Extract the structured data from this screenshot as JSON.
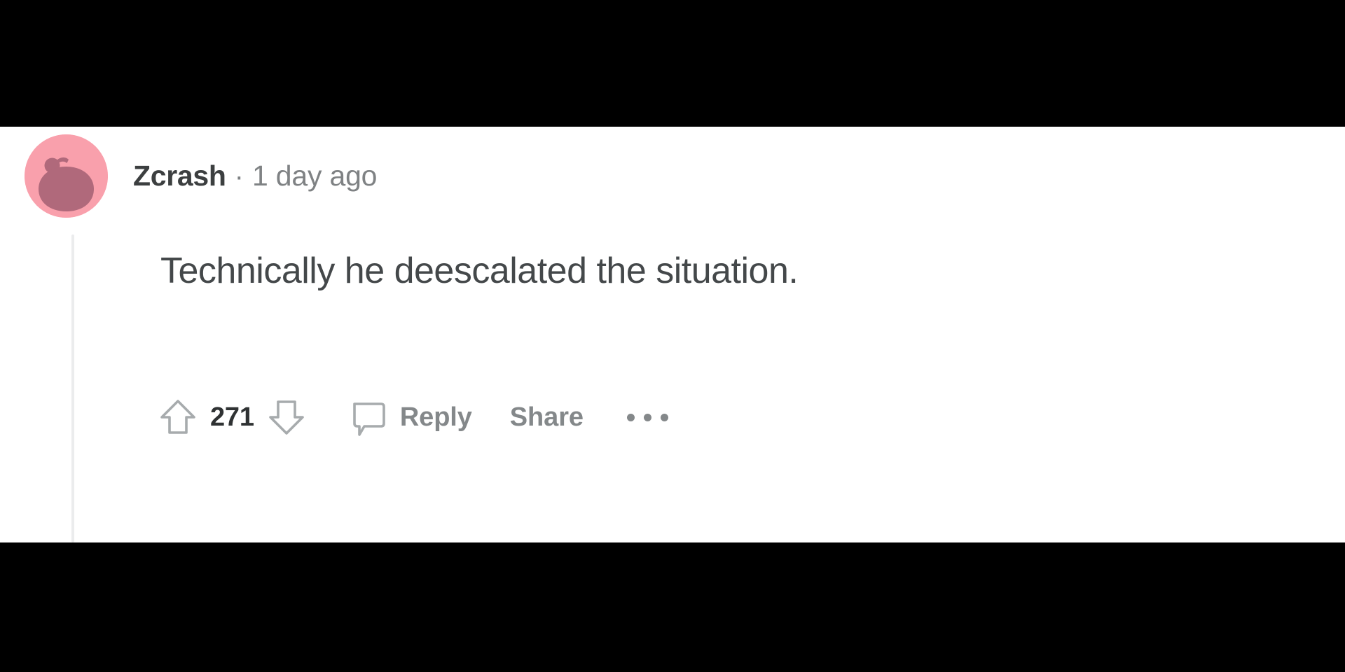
{
  "comment": {
    "author": "Zcrash",
    "separator": "·",
    "timestamp": "1 day ago",
    "body": "Technically he deescalated the situation.",
    "avatar": {
      "icon": "reddit-snoo-avatar",
      "background_color": "#F9A0AC",
      "figure_color": "#B0697B"
    }
  },
  "actions": {
    "upvote": {
      "icon": "upvote-arrow-icon",
      "label": "Upvote"
    },
    "vote_count": "271",
    "downvote": {
      "icon": "downvote-arrow-icon",
      "label": "Downvote"
    },
    "comment_icon": "speech-bubble-icon",
    "reply_label": "Reply",
    "share_label": "Share",
    "overflow": {
      "icon": "ellipsis-horizontal-icon",
      "label": "More options"
    }
  },
  "theme": {
    "text_primary": "#3c3f40",
    "text_secondary": "#7f8284",
    "body_text": "#44484a",
    "action_text": "#84888a",
    "icon_stroke": "#a7abad",
    "thread_line": "#ebeced",
    "page_background": "#ffffff",
    "letterbox": "#000000"
  }
}
